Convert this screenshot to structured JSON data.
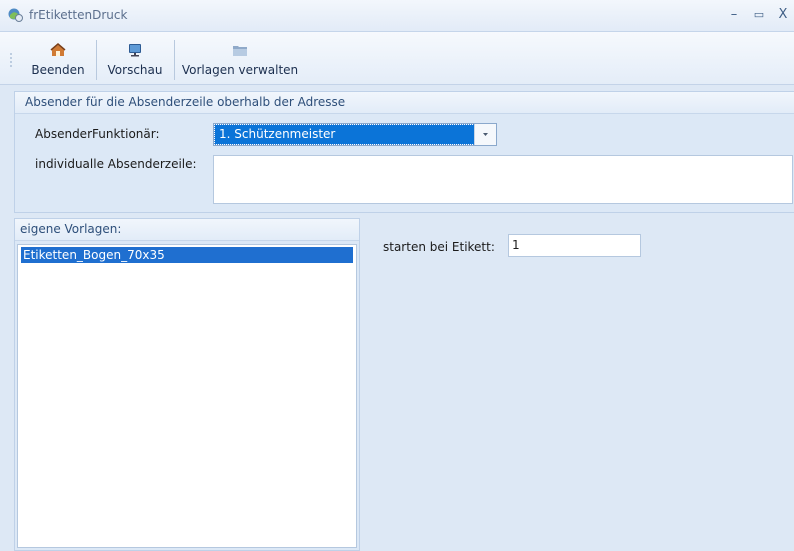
{
  "window": {
    "title": "frEtikettenDruck",
    "controls": [
      "–",
      "▭",
      "X"
    ]
  },
  "toolbar": {
    "buttons": [
      {
        "label": "Beenden",
        "icon": "house-exit-icon"
      },
      {
        "label": "Vorschau",
        "icon": "monitor-icon"
      },
      {
        "label": "Vorlagen verwalten",
        "icon": "folder-icon"
      }
    ]
  },
  "sender_group": {
    "title": "Absender für die Absenderzeile oberhalb der Adresse",
    "function_label": "AbsenderFunktionär:",
    "function_value": "1. Schützenmeister",
    "custom_label": "individualle Absenderzeile:",
    "custom_value": ""
  },
  "templates_group": {
    "title": "eigene Vorlagen:",
    "items": [
      "Etiketten_Bogen_70x35"
    ],
    "selected_index": 0
  },
  "start": {
    "label": "starten bei Etikett:",
    "value": "1"
  }
}
